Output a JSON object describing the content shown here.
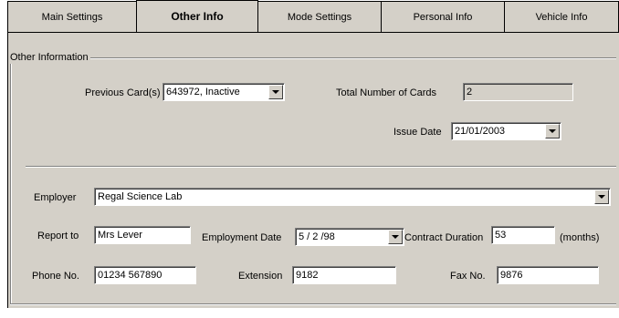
{
  "tabs": [
    {
      "label": "Main Settings"
    },
    {
      "label": "Other Info"
    },
    {
      "label": "Mode Settings"
    },
    {
      "label": "Personal Info"
    },
    {
      "label": "Vehicle Info"
    }
  ],
  "group": {
    "title": "Other Information"
  },
  "cards": {
    "previous_label": "Previous Card(s)",
    "previous_value": "643972, Inactive",
    "total_label": "Total Number of Cards",
    "total_value": "2",
    "issue_label": "Issue Date",
    "issue_value": "21/01/2003"
  },
  "employment": {
    "employer_label": "Employer",
    "employer_value": "Regal Science Lab",
    "report_label": "Report to",
    "report_value": "Mrs Lever",
    "date_label": "Employment Date",
    "date_value": "5 / 2 /98",
    "duration_label": "Contract Duration",
    "duration_value": "53",
    "duration_unit": "(months)",
    "phone_label": "Phone No.",
    "phone_value": "01234 567890",
    "ext_label": "Extension",
    "ext_value": "9182",
    "fax_label": "Fax No.",
    "fax_value": "9876"
  }
}
